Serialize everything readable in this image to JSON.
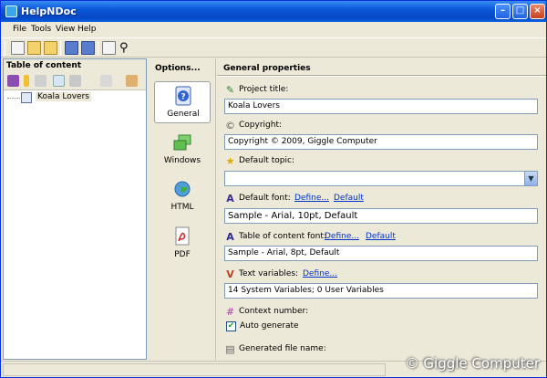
{
  "window": {
    "title": "HelpNDoc"
  },
  "menu": [
    "File",
    "Tools",
    "View",
    "Help"
  ],
  "toolbar": {
    "icons": [
      "new-icon",
      "open-icon",
      "open-folder-icon",
      "save-icon",
      "save-all-icon",
      "edit-icon",
      "find-icon"
    ]
  },
  "left_panel": {
    "title": "Table of content",
    "tree": [
      {
        "label": "Koala Lovers"
      }
    ]
  },
  "options": {
    "title": "Options...",
    "items": [
      {
        "label": "General",
        "icon": "general-help-icon",
        "active": true
      },
      {
        "label": "Windows",
        "icon": "windows-icon"
      },
      {
        "label": "HTML",
        "icon": "globe-icon"
      },
      {
        "label": "PDF",
        "icon": "pdf-icon"
      }
    ]
  },
  "general": {
    "title": "General properties",
    "project_title_label": "Project title:",
    "project_title_value": "Koala Lovers",
    "copyright_label": "Copyright:",
    "copyright_value": "Copyright © 2009, Giggle Computer",
    "default_topic_label": "Default topic:",
    "default_topic_value": "",
    "default_font_label": "Default font:",
    "default_font_define": "Define...",
    "default_font_default": "Default",
    "default_font_value": "Sample - Arial, 10pt, Default",
    "toc_font_label": "Table of content font:",
    "toc_font_define": "Define...",
    "toc_font_default": "Default",
    "toc_font_value": "Sample - Arial, 8pt, Default",
    "text_variables_label": "Text variables:",
    "text_variables_define": "Define...",
    "text_variables_value": "14 System Variables; 0 User Variables",
    "context_number_label": "Context number:",
    "auto_generate_label": "Auto generate",
    "auto_generate_checked": true,
    "generated_file_label": "Generated file name:"
  },
  "watermark": "© Giggle Computer"
}
